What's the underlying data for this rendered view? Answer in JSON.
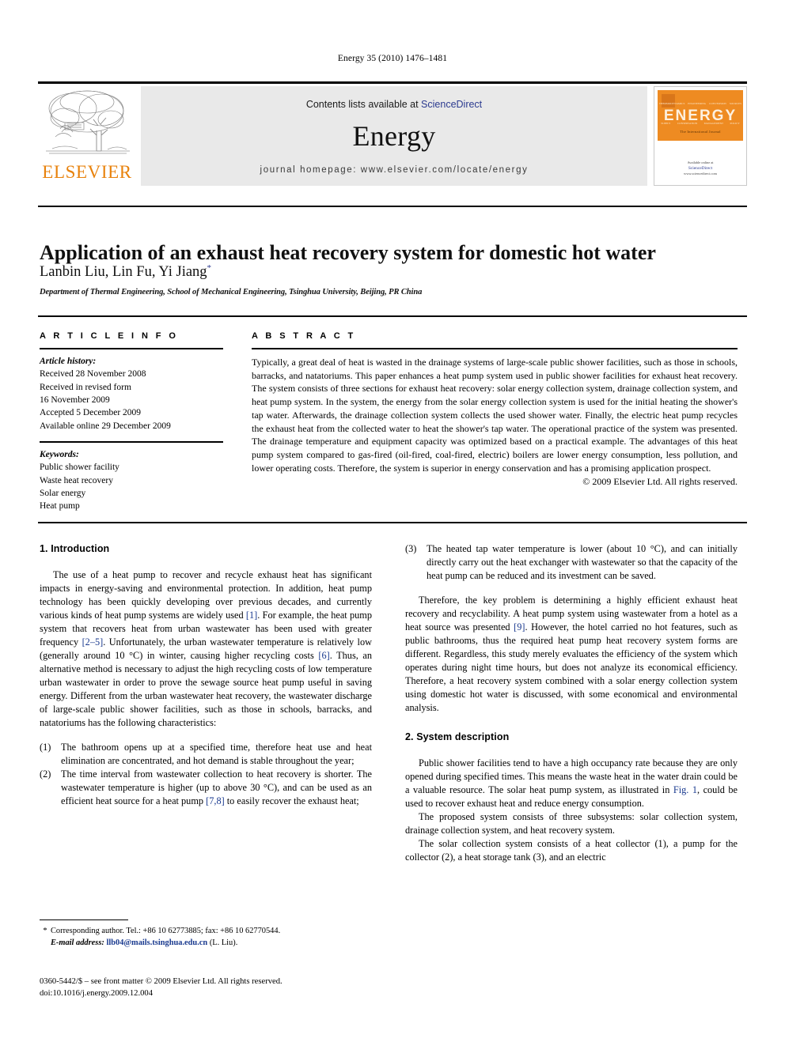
{
  "running_head": "Energy 35 (2010) 1476–1481",
  "masthead": {
    "publisher_name": "ELSEVIER",
    "contents_prefix": "Contents lists available at ",
    "sciencedirect": "ScienceDirect",
    "journal_name": "Energy",
    "homepage": "journal homepage: www.elsevier.com/locate/energy",
    "cover": {
      "title": "ENERGY",
      "subtitle": "The International Journal",
      "top_words": [
        "THERMODYNAMICS",
        "ENGINEERING",
        "CONVERSION",
        "SOURCES"
      ],
      "bottom_words": [
        "SUPPLY",
        "CONSERVATION",
        "MANAGEMENT",
        "POLICY"
      ],
      "available_online": "Available online at",
      "platform": "ScienceDirect",
      "platform_url": "www.sciencedirect.com"
    }
  },
  "article": {
    "title": "Application of an exhaust heat recovery system for domestic hot water",
    "authors": "Lanbin Liu, Lin Fu, Yi Jiang",
    "author_marker": "*",
    "affiliation": "Department of Thermal Engineering, School of Mechanical Engineering, Tsinghua University, Beijing, PR China"
  },
  "info": {
    "heading": "A R T I C L E   I N F O",
    "history_label": "Article history:",
    "history": [
      "Received 28 November 2008",
      "Received in revised form",
      "16 November 2009",
      "Accepted 5 December 2009",
      "Available online 29 December 2009"
    ],
    "keywords_label": "Keywords:",
    "keywords": [
      "Public shower facility",
      "Waste heat recovery",
      "Solar energy",
      "Heat pump"
    ]
  },
  "abstract": {
    "heading": "A B S T R A C T",
    "text": "Typically, a great deal of heat is wasted in the drainage systems of large-scale public shower facilities, such as those in schools, barracks, and natatoriums. This paper enhances a heat pump system used in public shower facilities for exhaust heat recovery. The system consists of three sections for exhaust heat recovery: solar energy collection system, drainage collection system, and heat pump system. In the system, the energy from the solar energy collection system is used for the initial heating the shower's tap water. Afterwards, the drainage collection system collects the used shower water. Finally, the electric heat pump recycles the exhaust heat from the collected water to heat the shower's tap water. The operational practice of the system was presented. The drainage temperature and equipment capacity was optimized based on a practical example. The advantages of this heat pump system compared to gas-fired (oil-fired, coal-fired, electric) boilers are lower energy consumption, less pollution, and lower operating costs. Therefore, the system is superior in energy conservation and has a promising application prospect.",
    "copyright": "© 2009 Elsevier Ltd. All rights reserved."
  },
  "body": {
    "section1_heading": "1. Introduction",
    "intro_p1_a": "The use of a heat pump to recover and recycle exhaust heat has significant impacts in energy-saving and environmental protection. In addition, heat pump technology has been quickly developing over previous decades, and currently various kinds of heat pump systems are widely used ",
    "ref1": "[1]",
    "intro_p1_b": ". For example, the heat pump system that recovers heat from urban wastewater has been used with greater frequency ",
    "ref2": "[2–5]",
    "intro_p1_c": ". Unfortunately, the urban wastewater temperature is relatively low (generally around 10 °C) in winter, causing higher recycling costs ",
    "ref3": "[6]",
    "intro_p1_d": ". Thus, an alternative method is necessary to adjust the high recycling costs of low temperature urban wastewater in order to prove the sewage source heat pump useful in saving energy. Different from the urban wastewater heat recovery, the wastewater discharge of large-scale public shower facilities, such as those in schools, barracks, and natatoriums has the following characteristics:",
    "list_items": [
      {
        "num": "(1)",
        "text": "The bathroom opens up at a specified time, therefore heat use and heat elimination are concentrated, and hot demand is stable throughout the year;"
      },
      {
        "num": "(2)",
        "text_a": "The time interval from wastewater collection to heat recovery is shorter. The wastewater temperature is higher (up to above 30 °C), and can be used as an efficient heat source for a heat pump ",
        "ref": "[7,8]",
        "text_b": " to easily recover the exhaust heat;"
      },
      {
        "num": "(3)",
        "text": "The heated tap water temperature is lower (about 10 °C), and can initially directly carry out the heat exchanger with wastewater so that the capacity of the heat pump can be reduced and its investment can be saved."
      }
    ],
    "intro_p2_a": "Therefore, the key problem is determining a highly efficient exhaust heat recovery and recyclability. A heat pump system using wastewater from a hotel as a heat source was presented ",
    "ref9": "[9]",
    "intro_p2_b": ". However, the hotel carried no hot features, such as public bathrooms, thus the required heat pump heat recovery system forms are different. Regardless, this study merely evaluates the efficiency of the system which operates during night time hours, but does not analyze its economical efficiency. Therefore, a heat recovery system combined with a solar energy collection system using domestic hot water is discussed, with some economical and environmental analysis.",
    "section2_heading": "2. System description",
    "sys_p1_a": "Public shower facilities tend to have a high occupancy rate because they are only opened during specified times. This means the waste heat in the water drain could be a valuable resource. The solar heat pump system, as illustrated in ",
    "fig1_ref": "Fig. 1",
    "sys_p1_b": ", could be used to recover exhaust heat and reduce energy consumption.",
    "sys_p2": "The proposed system consists of three subsystems: solar collection system, drainage collection system, and heat recovery system.",
    "sys_p3": "The solar collection system consists of a heat collector (1), a pump for the collector (2), a heat storage tank (3), and an electric"
  },
  "footnote": {
    "corresponding": "Corresponding author. Tel.: +86 10 62773885; fax: +86 10 62770544.",
    "email_label": "E-mail address:",
    "email": "llb04@mails.tsinghua.edu.cn",
    "email_suffix": "(L. Liu)."
  },
  "imprint": {
    "line1": "0360-5442/$ – see front matter © 2009 Elsevier Ltd. All rights reserved.",
    "line2": "doi:10.1016/j.energy.2009.12.004"
  }
}
